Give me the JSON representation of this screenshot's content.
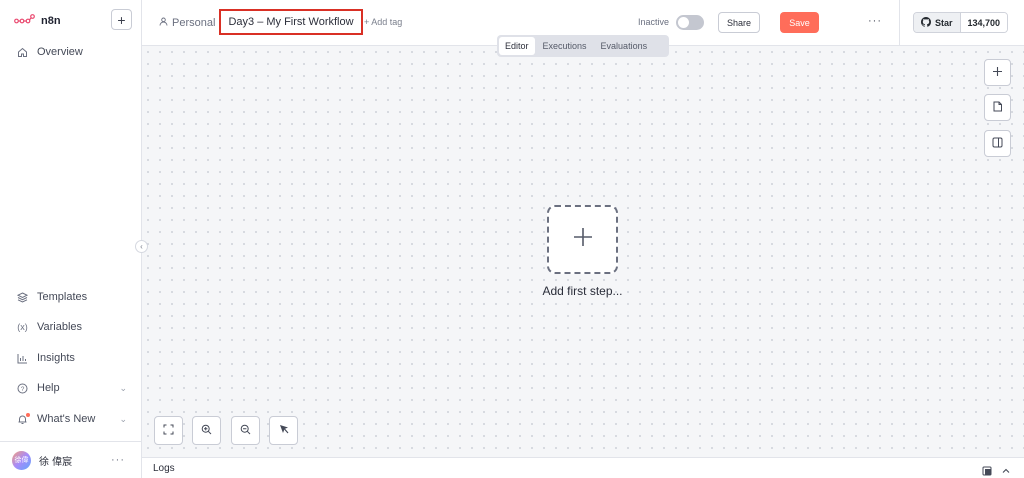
{
  "app": {
    "brand": "n8n",
    "accent_color": "#ff6d5a",
    "highlight_color": "#d93025"
  },
  "sidebar": {
    "new_button_label": "+",
    "items": [
      {
        "label": "Overview",
        "icon": "home-icon"
      },
      {
        "label": "Templates",
        "icon": "templates-icon"
      },
      {
        "label": "Variables",
        "icon": "variables-icon"
      },
      {
        "label": "Insights",
        "icon": "insights-icon"
      },
      {
        "label": "Help",
        "icon": "help-icon"
      },
      {
        "label": "What's New",
        "icon": "bell-icon"
      }
    ],
    "user": {
      "initials": "徐偉",
      "name": "徐 偉宸"
    }
  },
  "header": {
    "project": "Personal",
    "workflow_name": "Day3 – My First Workflow",
    "add_tag": "+ Add tag",
    "status_label": "Inactive",
    "share_label": "Share",
    "save_label": "Save",
    "github": {
      "star_label": "Star",
      "count": "134,700"
    }
  },
  "mode_tabs": [
    {
      "label": "Editor",
      "active": true
    },
    {
      "label": "Executions",
      "active": false
    },
    {
      "label": "Evaluations",
      "active": false
    }
  ],
  "canvas": {
    "add_first_step": "Add first step..."
  },
  "logs": {
    "label": "Logs"
  }
}
